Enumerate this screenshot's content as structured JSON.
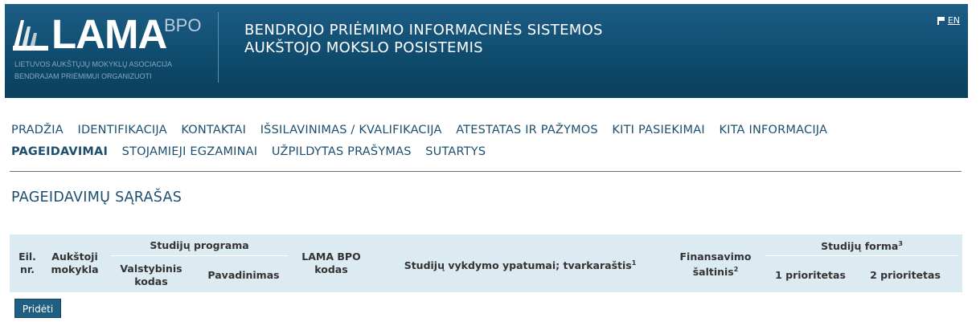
{
  "header": {
    "logo_text": "LAMA",
    "logo_sup": "BPO",
    "logo_sub_line1": "LIETUVOS AUKŠTŲJŲ MOKYKLŲ ASOCIACIJA",
    "logo_sub_line2": "BENDRAJAM PRIĖMIMUI ORGANIZUOTI",
    "title_line1": "BENDROJO PRIĖMIMO INFORMACINĖS SISTEMOS",
    "title_line2": "AUKŠTOJO MOKSLO POSISTEMIS",
    "lang_label": "EN",
    "lang_icon": "flag-icon"
  },
  "nav": {
    "row1": [
      "PRADŽIA",
      "IDENTIFIKACIJA",
      "KONTAKTAI",
      "IŠSILAVINIMAS / KVALIFIKACIJA",
      "ATESTATAS IR PAŽYMOS",
      "KITI PASIEKIMAI",
      "KITA INFORMACIJA"
    ],
    "row2": [
      "PAGEIDAVIMAI",
      "STOJAMIEJI EGZAMINAI",
      "UŽPILDYTAS PRAŠYMAS",
      "SUTARTYS"
    ],
    "active": "PAGEIDAVIMAI"
  },
  "page_title": "PAGEIDAVIMŲ SĄRAŠAS",
  "table": {
    "col_no_line1": "Eil.",
    "col_no_line2": "nr.",
    "col_school_line1": "Aukštoji",
    "col_school_line2": "mokykla",
    "group_program": "Studijų programa",
    "col_state_code_line1": "Valstybinis",
    "col_state_code_line2": "kodas",
    "col_name": "Pavadinimas",
    "col_lama_line1": "LAMA BPO",
    "col_lama_line2": "kodas",
    "col_features": "Studijų vykdymo ypatumai; tvarkaraštis",
    "col_features_sup": "1",
    "col_funding_line1": "Finansavimo",
    "col_funding_line2": "šaltinis",
    "col_funding_sup": "2",
    "group_form": "Studijų forma",
    "group_form_sup": "3",
    "col_priority1": "1 prioritetas",
    "col_priority2": "2 prioritetas"
  },
  "buttons": {
    "add": "Pridėti"
  },
  "colors": {
    "header_bg": "#0e4a6c",
    "nav_text": "#1c4f6f",
    "table_header_bg": "#dceaf1",
    "button_bg": "#1f5f82"
  }
}
